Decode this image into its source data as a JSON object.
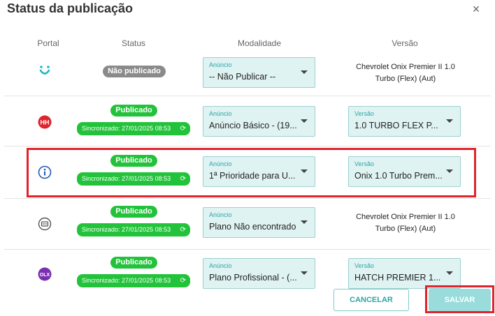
{
  "dialog": {
    "title": "Status da publicação",
    "close_icon": "×"
  },
  "columns": {
    "portal": "Portal",
    "status": "Status",
    "modalidade": "Modalidade",
    "versao": "Versão"
  },
  "rows": [
    {
      "portal_icon": "u-smile-icon",
      "status": "Não publicado",
      "modalidade": {
        "label": "Anúncio",
        "value": "-- Não Publicar --"
      },
      "versao_text_1": "Chevrolet Onix Premier II 1.0",
      "versao_text_2": "Turbo (Flex) (Aut)"
    },
    {
      "portal_icon": "hh-icon",
      "status": "Publicado",
      "sync": "Sincronizado: 27/01/2025 08:53",
      "modalidade": {
        "label": "Anúncio",
        "value": "Anúncio Básico - (19..."
      },
      "versao": {
        "label": "Versão",
        "value": "1.0 TURBO FLEX P..."
      }
    },
    {
      "portal_icon": "info-circle-icon",
      "status": "Publicado",
      "sync": "Sincronizado: 27/01/2025 08:53",
      "modalidade": {
        "label": "Anúncio",
        "value": "1ª Prioridade para U..."
      },
      "versao": {
        "label": "Versão",
        "value": "Onix 1.0 Turbo Prem..."
      }
    },
    {
      "portal_icon": "card-icon",
      "status": "Publicado",
      "sync": "Sincronizado: 27/01/2025 08:53",
      "modalidade": {
        "label": "Anúncio",
        "value": "Plano Não encontrado"
      },
      "versao_text_1": "Chevrolet Onix Premier II 1.0",
      "versao_text_2": "Turbo (Flex) (Aut)"
    },
    {
      "portal_icon": "olx-icon",
      "status": "Publicado",
      "sync": "Sincronizado: 27/01/2025 08:53",
      "modalidade": {
        "label": "Anúncio",
        "value": "Plano Profissional - (..."
      },
      "versao": {
        "label": "Versão",
        "value": "HATCH PREMIER 1..."
      }
    }
  ],
  "icons": {
    "hh": "HH",
    "olx": "OLX"
  },
  "buttons": {
    "cancel": "CANCELAR",
    "save": "SALVAR"
  },
  "colors": {
    "accent": "#2ca6a6",
    "published": "#22c33a",
    "not_published": "#8a8a8a",
    "highlight": "#e0242c"
  }
}
